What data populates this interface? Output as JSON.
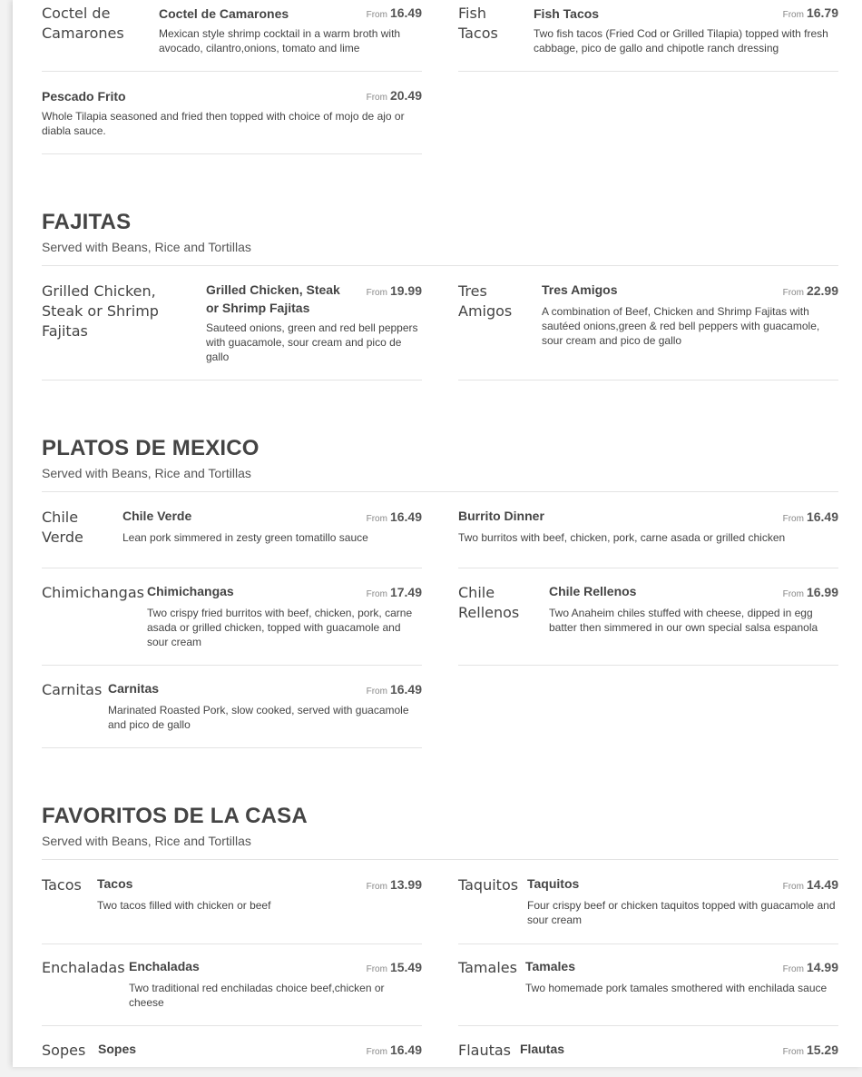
{
  "from_label": "From",
  "top_items": [
    {
      "img_alt": "Coctel de Camarones",
      "name": "Coctel de Camarones",
      "price": "16.49",
      "desc": "Mexican style shrimp cocktail in a warm broth with avocado, cilantro,onions, tomato and lime"
    },
    {
      "img_alt": "Fish Tacos",
      "name": "Fish Tacos",
      "price": "16.79",
      "desc": "Two fish tacos (Fried Cod or Grilled Tilapia) topped with fresh cabbage, pico de gallo and chipotle ranch dressing"
    },
    {
      "name": "Pescado Frito",
      "price": "20.49",
      "desc": "Whole Tilapia seasoned and fried then topped with choice of mojo de ajo or diabla sauce."
    }
  ],
  "sections": [
    {
      "title": "FAJITAS",
      "subtitle": "Served with Beans, Rice and Tortillas",
      "items": [
        {
          "img_alt": "Grilled Chicken, Steak or Shrimp Fajitas",
          "name": "Grilled Chicken, Steak or Shrimp Fajitas",
          "price": "19.99",
          "desc": "Sauteed onions, green and red bell peppers with guacamole, sour cream and pico de gallo"
        },
        {
          "img_alt": "Tres Amigos",
          "name": "Tres Amigos",
          "price": "22.99",
          "desc": "A combination of Beef, Chicken and Shrimp Fajitas with sautéed onions,green & red bell peppers with guacamole, sour cream and pico de gallo"
        }
      ]
    },
    {
      "title": "PLATOS DE MEXICO",
      "subtitle": "Served with Beans, Rice and Tortillas",
      "items": [
        {
          "img_alt": "Chile Verde",
          "name": "Chile Verde",
          "price": "16.49",
          "desc": "Lean pork simmered in zesty green tomatillo sauce"
        },
        {
          "name": "Burrito Dinner",
          "price": "16.49",
          "desc": "Two burritos with beef, chicken, pork, carne asada or grilled chicken"
        },
        {
          "img_alt": "Chimichangas",
          "name": "Chimichangas",
          "price": "17.49",
          "desc": "Two crispy fried burritos with beef, chicken, pork, carne asada or grilled chicken, topped with guacamole and sour cream"
        },
        {
          "img_alt": "Chile Rellenos",
          "name": "Chile Rellenos",
          "price": "16.99",
          "desc": "Two Anaheim chiles stuffed with cheese, dipped in egg batter then simmered in our own special salsa espanola"
        },
        {
          "img_alt": "Carnitas",
          "name": "Carnitas",
          "price": "16.49",
          "desc": "Marinated Roasted Pork, slow cooked, served with guacamole and pico de gallo"
        }
      ]
    },
    {
      "title": "FAVORITOS DE LA CASA",
      "subtitle": "Served with Beans, Rice and Tortillas",
      "items": [
        {
          "img_alt": "Tacos",
          "name": "Tacos",
          "price": "13.99",
          "desc": "Two tacos filled with chicken or beef"
        },
        {
          "img_alt": "Taquitos",
          "name": "Taquitos",
          "price": "14.49",
          "desc": "Four crispy beef or chicken taquitos topped with guacamole and sour cream"
        },
        {
          "img_alt": "Enchaladas",
          "name": "Enchaladas",
          "price": "15.49",
          "desc": "Two traditional red enchiladas choice beef,chicken or cheese"
        },
        {
          "img_alt": "Tamales",
          "name": "Tamales",
          "price": "14.99",
          "desc": "Two homemade pork tamales smothered with enchilada sauce"
        },
        {
          "img_alt": "Sopes",
          "name": "Sopes",
          "price": "16.49",
          "desc": ""
        },
        {
          "img_alt": "Flautas",
          "name": "Flautas",
          "price": "15.29",
          "desc": ""
        }
      ]
    }
  ]
}
